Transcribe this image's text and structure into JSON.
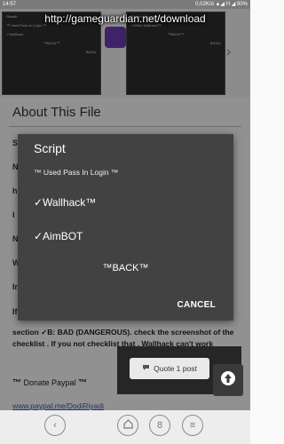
{
  "statusbar": {
    "time": "14:57",
    "right": "0,02K/d  ▲◢ H ◢ 90%"
  },
  "watermark": {
    "url": "http://gameguardian.net/download"
  },
  "page": {
    "shot1_lines": [
      "Stealth",
      "™ Used Pass In Login ™",
      "✓Wallhack",
      "™BACK™",
      "BATAL"
    ],
    "shot2_lines": [
      "™ Used Pass In Login ™",
      "✓White Wallhack™",
      "™BACK™",
      "BATAL"
    ],
    "section_title": "About This File",
    "frags": [
      "S",
      "N",
      "h",
      "I",
      "N",
      "W",
      "In",
      "If"
    ],
    "body_text": "section ✓B: BAD (DANGEROUS). check the screenshot of the checklist . If you not checklist that . Wallhack can't work",
    "donate_label": "Donate Paypal",
    "tm": "™",
    "paypal_link": "www.paypal.me/DodiRiyadi",
    "quote_label": "Quote 1 post",
    "tab_count": "8"
  },
  "dialog": {
    "title": "Script",
    "subtitle": "™ Used Pass In Login ™",
    "option1": "✓Wallhack™",
    "option2": "✓AimBOT",
    "back": "™BACK™",
    "cancel": "CANCEL"
  },
  "icons": {
    "back": "chevron-left-icon",
    "home": "home-icon",
    "tabs": "tabs-icon",
    "menu": "menu-icon",
    "scroll_top": "arrow-up-icon",
    "quote": "quote-icon"
  }
}
